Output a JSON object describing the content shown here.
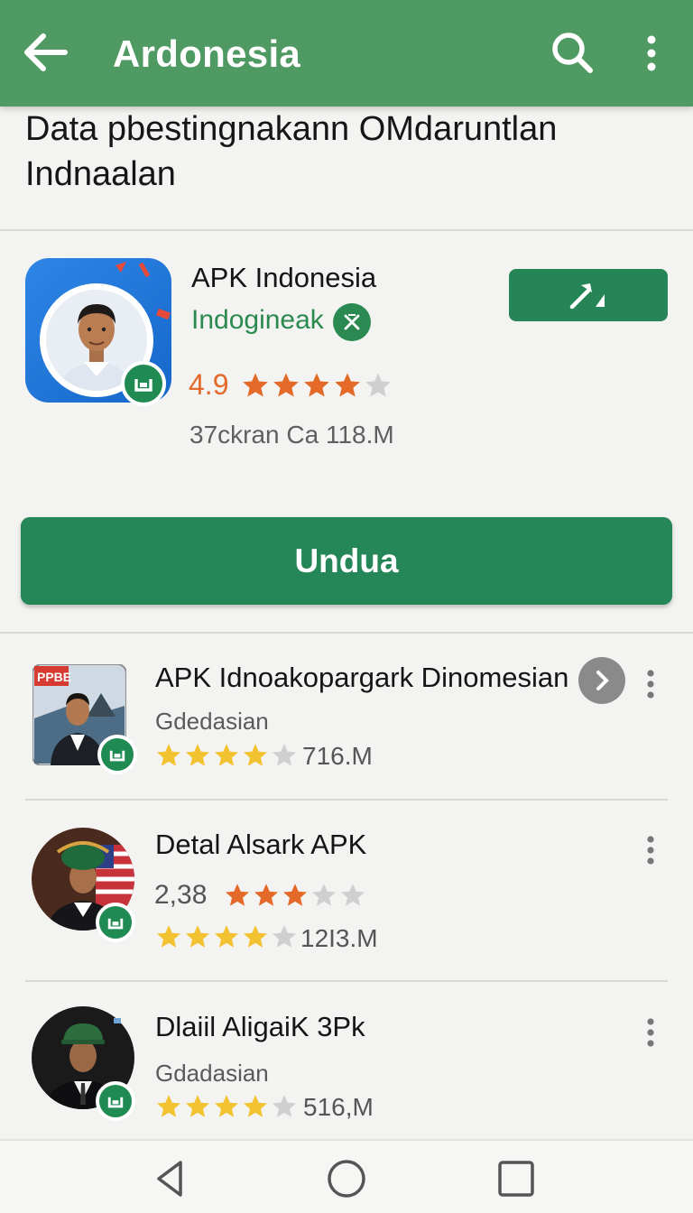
{
  "appbar": {
    "title": "Ardonesia",
    "back_icon": "arrow-left-icon",
    "search_icon": "search-icon",
    "menu_icon": "more-vert-icon"
  },
  "heading": "Data pbestingnakann OMdaruntlan Indnaalan",
  "featured": {
    "name": "APK Indonesia",
    "developer": "Indogineak",
    "rating": "4.9",
    "stars_filled": 4,
    "meta": "37ckran Ca 118.M",
    "action_icon": "hammer-icon",
    "install_label": "Undua"
  },
  "list": [
    {
      "name": "APK Idnoakopargark Dinomesian",
      "sub": "Gdedasian",
      "stars_filled": 4,
      "size": "716.M",
      "has_arrow": true
    },
    {
      "name": "Detal Alsark APK",
      "rating": "2,38",
      "rating_stars": 3,
      "stars_filled": 4,
      "size": "12I3.M"
    },
    {
      "name": "Dlaiil AligaiK 3Pk",
      "sub": "Gdadasian",
      "stars_filled": 4,
      "size": "516,M"
    }
  ],
  "colors": {
    "appbar": "#4f9a63",
    "primary": "#258757",
    "rating_orange": "#e46a2a",
    "star_yellow": "#f2c230"
  }
}
